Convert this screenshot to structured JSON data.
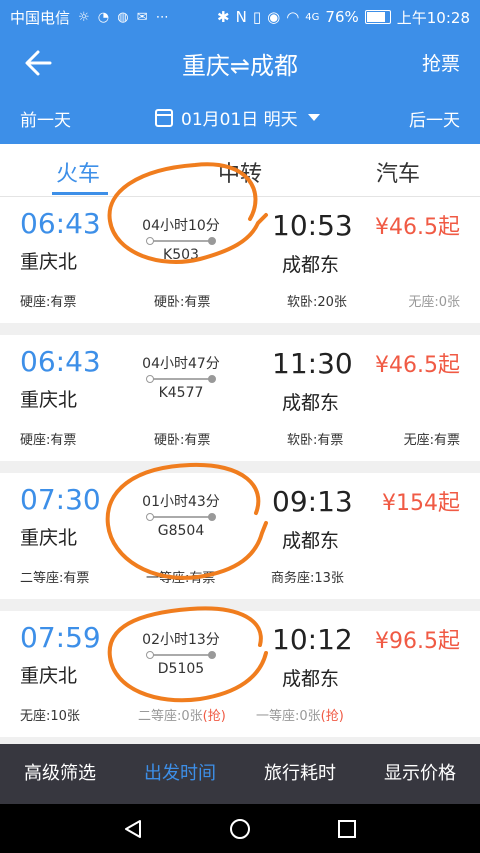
{
  "status": {
    "carrier": "中国电信",
    "network": "4G",
    "battery": "76%",
    "time": "上午10:28"
  },
  "header": {
    "title": "重庆⇌成都",
    "grab": "抢票"
  },
  "datebar": {
    "prev": "前一天",
    "date": "01月01日 明天",
    "next": "后一天"
  },
  "tabs": [
    {
      "label": "火车"
    },
    {
      "label": "中转"
    },
    {
      "label": "汽车"
    }
  ],
  "trains": [
    {
      "depart": "06:43",
      "arrive": "10:53",
      "price": "¥46.5起",
      "from": "重庆北",
      "to": "成都东",
      "duration": "04小时10分",
      "code": "K503",
      "seats": [
        {
          "label": "硬座:有票"
        },
        {
          "label": "硬卧:有票"
        },
        {
          "label": "软卧:20张"
        },
        {
          "label": "无座:0张"
        }
      ]
    },
    {
      "depart": "06:43",
      "arrive": "11:30",
      "price": "¥46.5起",
      "from": "重庆北",
      "to": "成都东",
      "duration": "04小时47分",
      "code": "K4577",
      "seats": [
        {
          "label": "硬座:有票"
        },
        {
          "label": "硬卧:有票"
        },
        {
          "label": "软卧:有票"
        },
        {
          "label": "无座:有票"
        }
      ]
    },
    {
      "depart": "07:30",
      "arrive": "09:13",
      "price": "¥154起",
      "from": "重庆北",
      "to": "成都东",
      "duration": "01小时43分",
      "code": "G8504",
      "seats": [
        {
          "label": "二等座:有票"
        },
        {
          "label": "一等座:有票"
        },
        {
          "label": "商务座:13张"
        }
      ]
    },
    {
      "depart": "07:59",
      "arrive": "10:12",
      "price": "¥96.5起",
      "from": "重庆北",
      "to": "成都东",
      "duration": "02小时13分",
      "code": "D5105",
      "seats": [
        {
          "label": "无座:10张"
        },
        {
          "label": "二等座:0张"
        },
        {
          "label": "一等座:0张"
        }
      ],
      "grab_tag": "(抢)"
    }
  ],
  "bottombar": [
    {
      "label": "高级筛选"
    },
    {
      "label": "出发时间"
    },
    {
      "label": "旅行耗时"
    },
    {
      "label": "显示价格"
    }
  ],
  "colors": {
    "primary": "#3d8fe8",
    "price": "#f05a44",
    "annotation": "#f07d1e",
    "bottombar": "#37373f"
  }
}
